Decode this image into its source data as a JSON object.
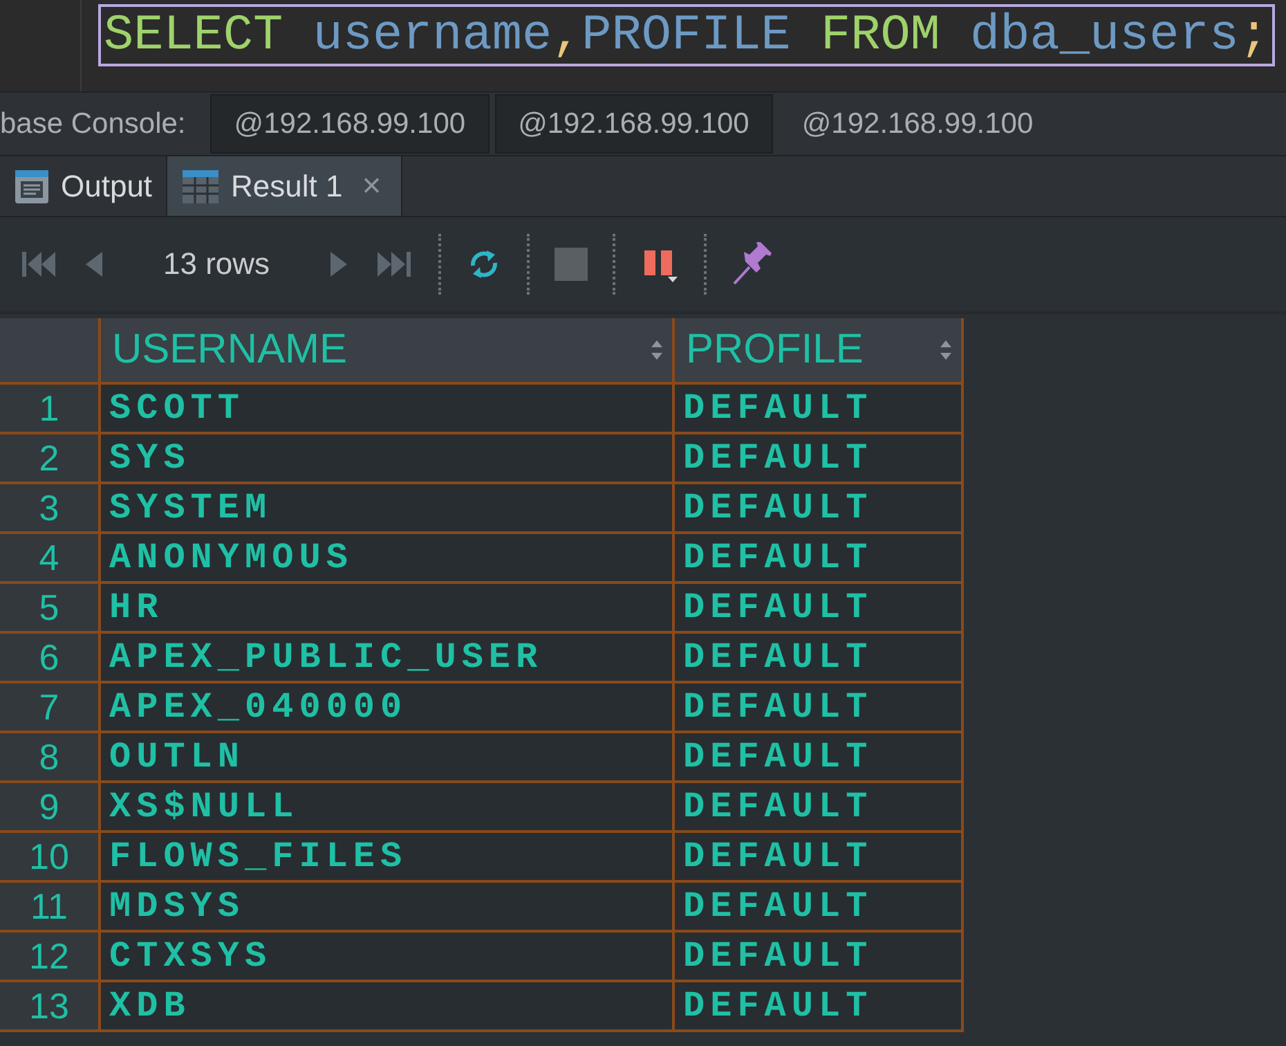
{
  "query": [
    {
      "text": "SELECT ",
      "kind": "keyword"
    },
    {
      "text": "username",
      "kind": "identifier"
    },
    {
      "text": ",",
      "kind": "punct"
    },
    {
      "text": "PROFILE ",
      "kind": "identifier"
    },
    {
      "text": "FROM ",
      "kind": "keyword"
    },
    {
      "text": "dba_users",
      "kind": "identifier"
    },
    {
      "text": ";",
      "kind": "punct"
    }
  ],
  "console_tabs": {
    "label": "base Console:",
    "tabs": [
      {
        "label": "@192.168.99.100",
        "selected": true
      },
      {
        "label": "@192.168.99.100",
        "selected": true
      },
      {
        "label": "@192.168.99.100",
        "selected": false
      }
    ]
  },
  "result_tabs": [
    {
      "label": "Output",
      "selected": false,
      "kind": "output"
    },
    {
      "label": "Result 1",
      "selected": true,
      "kind": "result",
      "close": "×"
    }
  ],
  "toolbar": {
    "row_count": "13 rows"
  },
  "table": {
    "columns": [
      "",
      "USERNAME",
      "PROFILE"
    ],
    "rows": [
      [
        "1",
        "SCOTT",
        "DEFAULT"
      ],
      [
        "2",
        "SYS",
        "DEFAULT"
      ],
      [
        "3",
        "SYSTEM",
        "DEFAULT"
      ],
      [
        "4",
        "ANONYMOUS",
        "DEFAULT"
      ],
      [
        "5",
        "HR",
        "DEFAULT"
      ],
      [
        "6",
        "APEX_PUBLIC_USER",
        "DEFAULT"
      ],
      [
        "7",
        "APEX_040000",
        "DEFAULT"
      ],
      [
        "8",
        "OUTLN",
        "DEFAULT"
      ],
      [
        "9",
        "XS$NULL",
        "DEFAULT"
      ],
      [
        "10",
        "FLOWS_FILES",
        "DEFAULT"
      ],
      [
        "11",
        "MDSYS",
        "DEFAULT"
      ],
      [
        "12",
        "CTXSYS",
        "DEFAULT"
      ],
      [
        "13",
        "XDB",
        "DEFAULT"
      ]
    ]
  }
}
